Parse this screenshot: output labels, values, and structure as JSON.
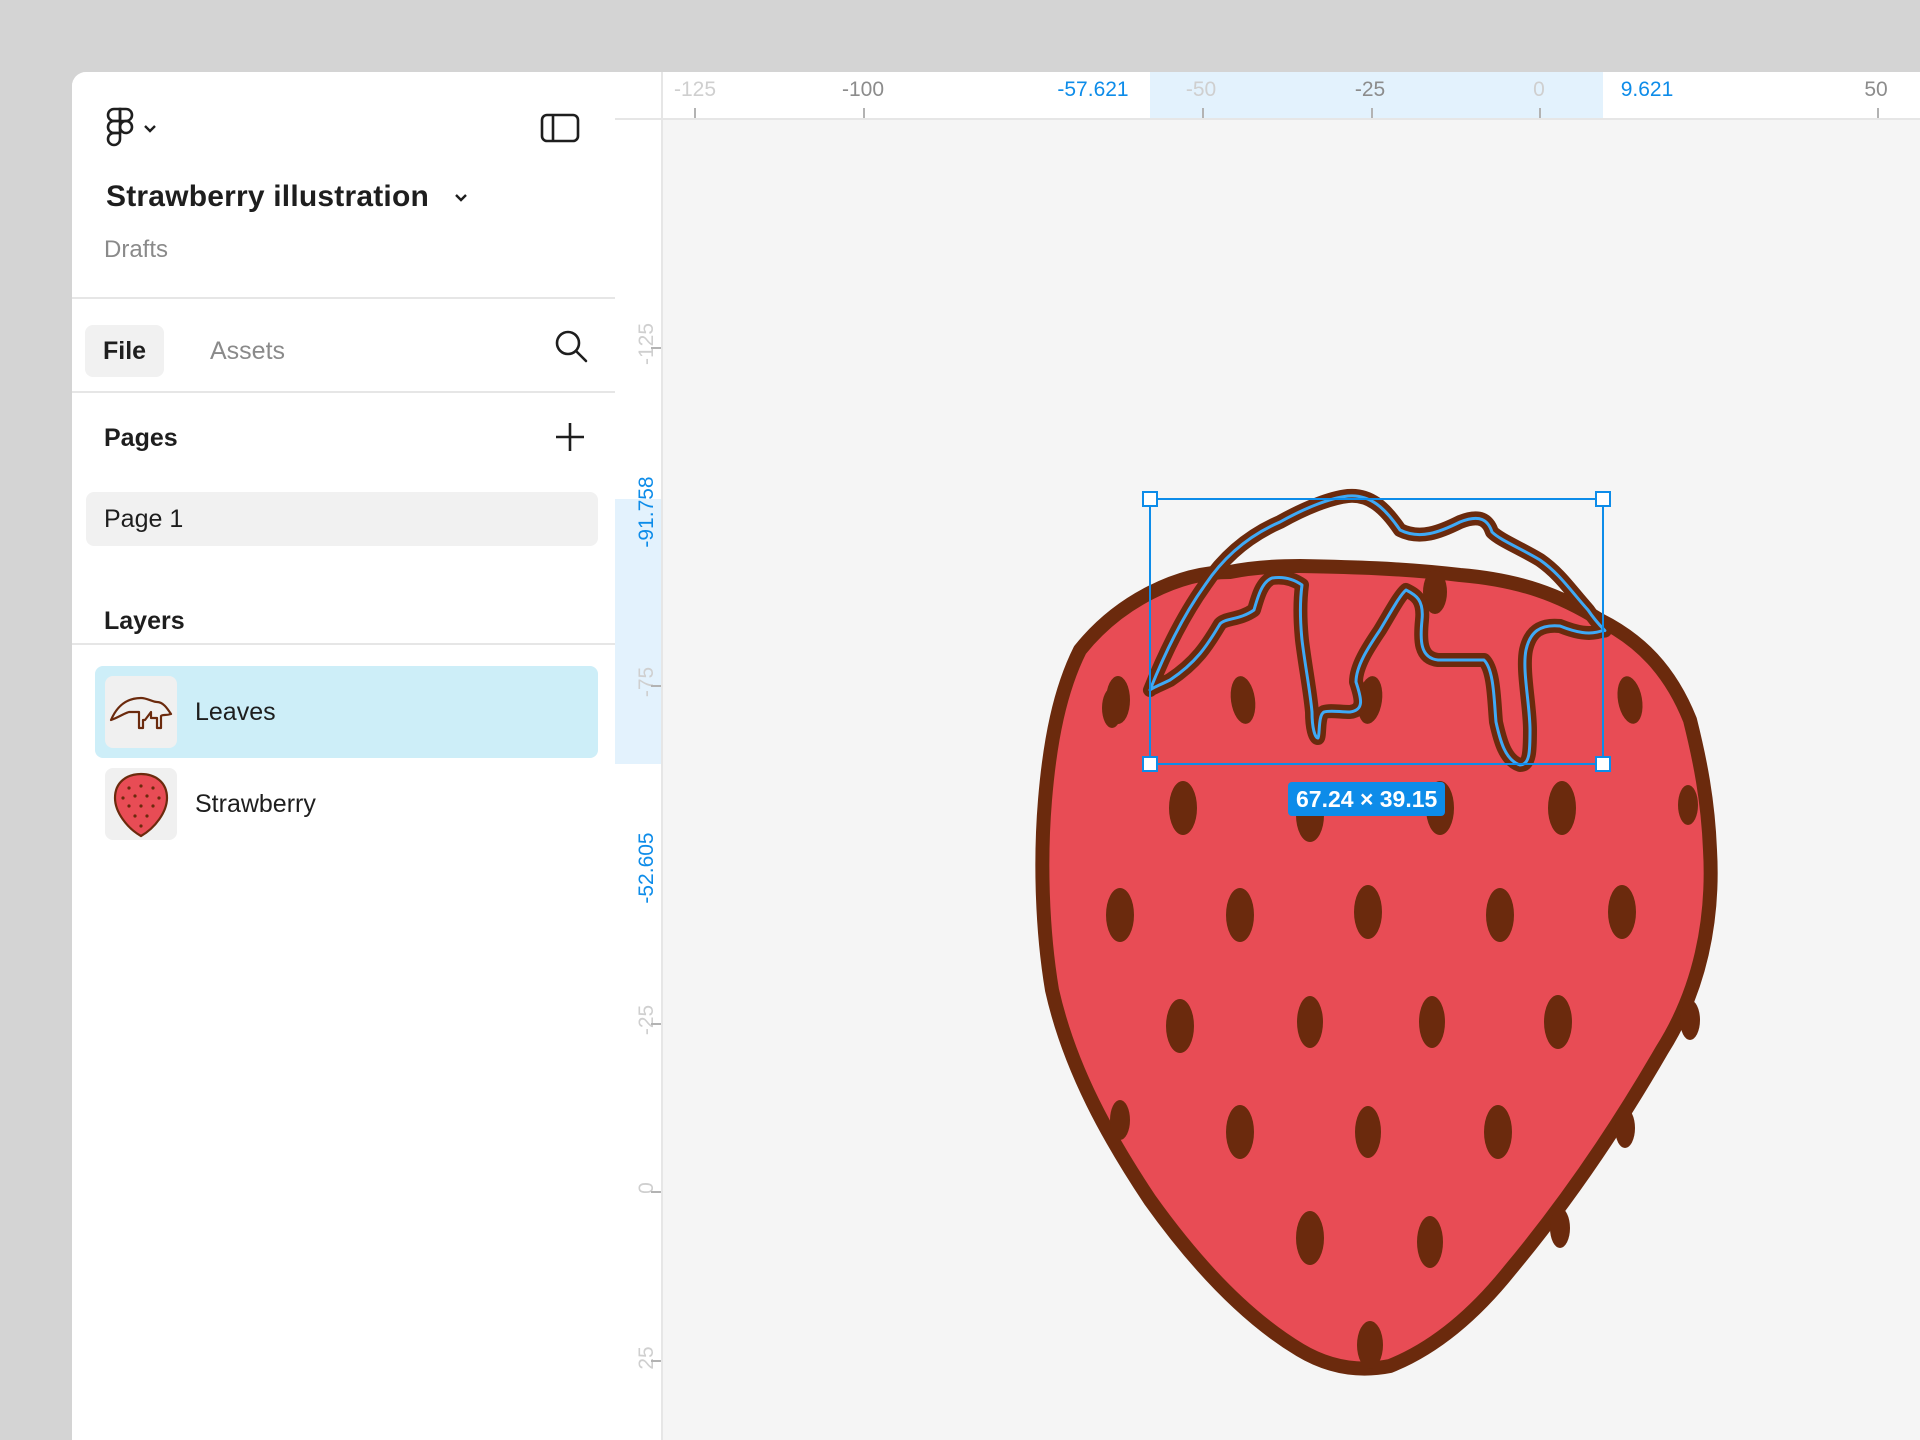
{
  "app": {
    "file_title": "Strawberry illustration",
    "file_location": "Drafts"
  },
  "tabs": {
    "file": "File",
    "assets": "Assets"
  },
  "pages": {
    "heading": "Pages",
    "items": [
      "Page 1"
    ]
  },
  "layers": {
    "heading": "Layers",
    "items": [
      {
        "label": "Leaves",
        "selected": true,
        "icon": "leaves-thumbnail"
      },
      {
        "label": "Strawberry",
        "selected": false,
        "icon": "strawberry-thumbnail"
      }
    ]
  },
  "rulers": {
    "top": [
      "-125",
      "-100",
      "-57.621",
      "-50",
      "-25",
      "0",
      "9.621",
      "50"
    ],
    "left": [
      "-125",
      "-91.758",
      "-75",
      "-52.605",
      "-25",
      "0",
      "25"
    ]
  },
  "selection": {
    "dimensions": "67.24 × 39.15"
  },
  "colors": {
    "accent": "#0d8ce9",
    "strawberry_fill": "#e84c55",
    "strawberry_outline": "#6b2a0d",
    "selected_layer_bg": "#cdeef8"
  }
}
